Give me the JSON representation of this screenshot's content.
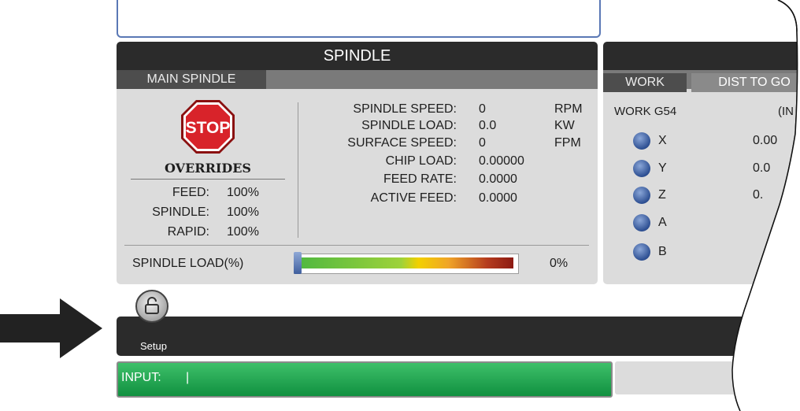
{
  "spindle": {
    "title": "SPINDLE",
    "tab": "MAIN SPINDLE",
    "stop_label": "STOP",
    "overrides_title": "OVERRIDES",
    "overrides": [
      {
        "label": "FEED:",
        "value": "100%"
      },
      {
        "label": "SPINDLE:",
        "value": "100%"
      },
      {
        "label": "RAPID:",
        "value": "100%"
      }
    ],
    "stats": [
      {
        "label": "SPINDLE SPEED:",
        "value": "0",
        "unit": "RPM"
      },
      {
        "label": "SPINDLE LOAD:",
        "value": "0.0",
        "unit": "KW"
      },
      {
        "label": "SURFACE SPEED:",
        "value": "0",
        "unit": "FPM"
      },
      {
        "label": "CHIP LOAD:",
        "value": "0.00000",
        "unit": ""
      },
      {
        "label": "FEED RATE:",
        "value": "0.0000",
        "unit": ""
      },
      {
        "label": "ACTIVE FEED:",
        "value": "0.0000",
        "unit": ""
      }
    ],
    "load_label": "SPINDLE LOAD(%)",
    "load_value": "0%",
    "load_fraction": 0
  },
  "work": {
    "tabs": [
      "WORK",
      "DIST TO GO"
    ],
    "offset_label": "WORK G54",
    "units_fragment": "(IN",
    "axes": [
      {
        "name": "X",
        "value": "0.00"
      },
      {
        "name": "Y",
        "value": "0.0"
      },
      {
        "name": "Z",
        "value": "0."
      },
      {
        "name": "A",
        "value": ""
      },
      {
        "name": "B",
        "value": ""
      }
    ]
  },
  "toolbar": {
    "setup_label": "Setup"
  },
  "input": {
    "label": "INPUT:",
    "cursor": "|"
  },
  "icons": {
    "stop": "stop-sign-icon",
    "home": "home-icon",
    "unlock": "unlock-icon",
    "pointer": "arrow-pointer-icon"
  },
  "colors": {
    "input_bg": "#1fa54c",
    "stop_red": "#d8232a",
    "accent_blue": "#5a78b5"
  }
}
